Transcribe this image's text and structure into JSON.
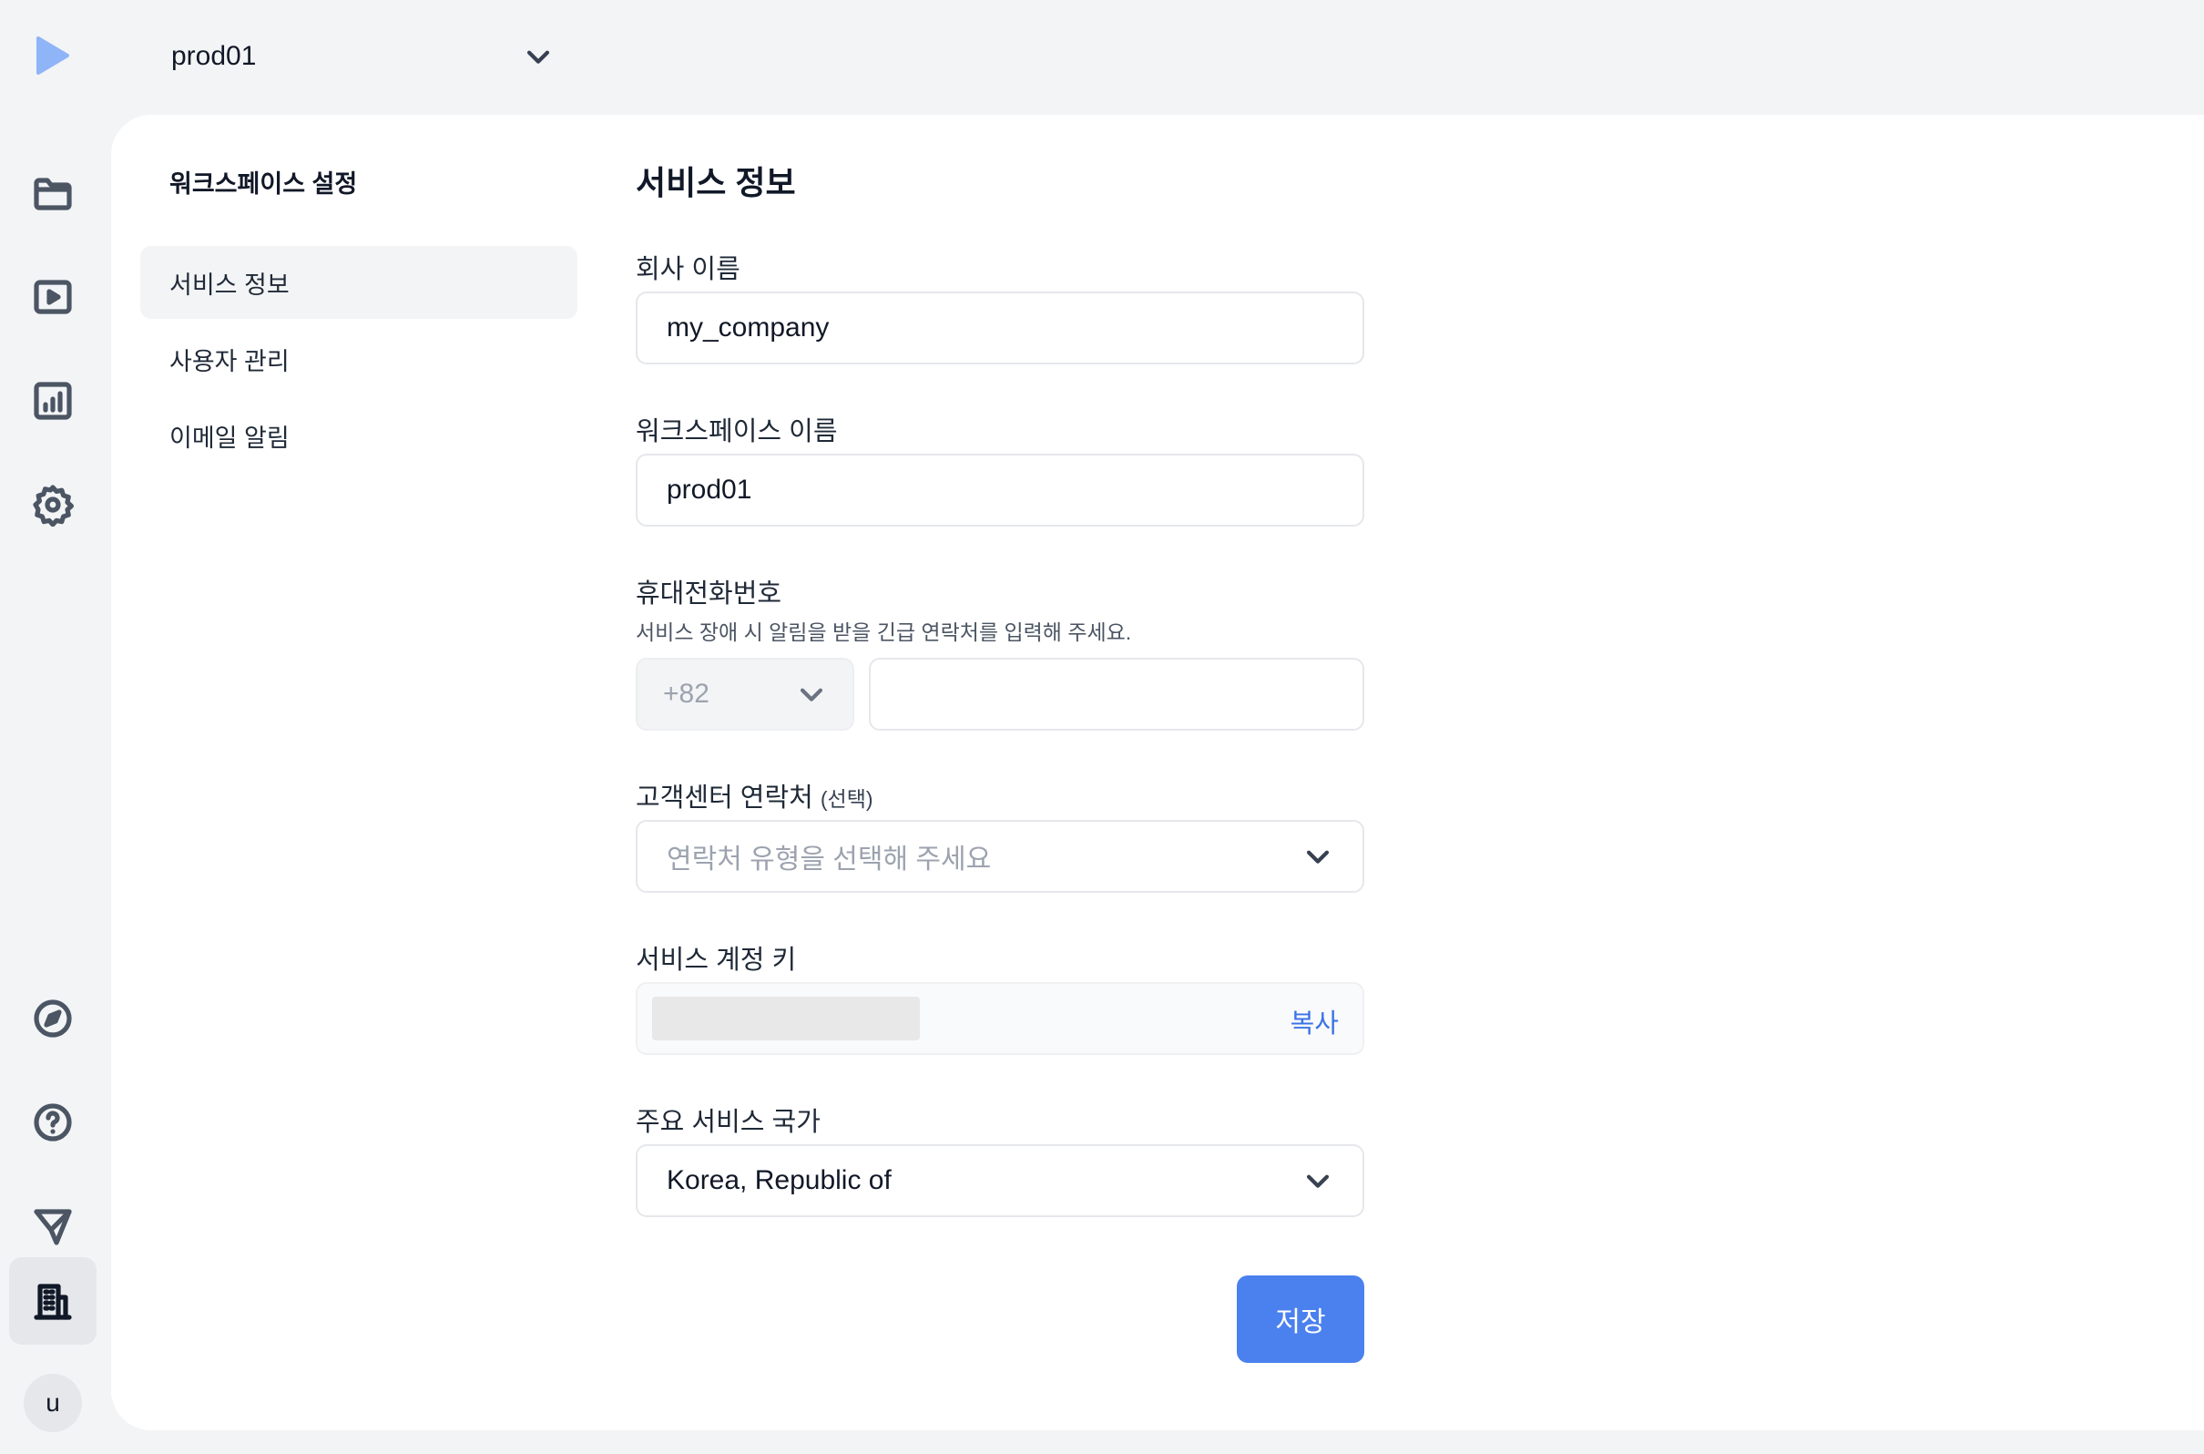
{
  "workspace_select": {
    "value": "prod01"
  },
  "sidebar": {
    "title": "워크스페이스 설정",
    "items": [
      {
        "label": "서비스 정보",
        "active": true
      },
      {
        "label": "사용자 관리",
        "active": false
      },
      {
        "label": "이메일 알림",
        "active": false
      }
    ]
  },
  "rail": {
    "top_icons": [
      "folder-icon",
      "play-icon",
      "chart-icon",
      "gear-icon"
    ],
    "bottom_icons": [
      "compass-icon",
      "help-icon",
      "send-icon",
      "building-icon"
    ],
    "active_icon": "building-icon",
    "avatar_initial": "u"
  },
  "main": {
    "title": "서비스 정보",
    "company_name": {
      "label": "회사 이름",
      "value": "my_company"
    },
    "workspace_name": {
      "label": "워크스페이스 이름",
      "value": "prod01"
    },
    "phone": {
      "label": "휴대전화번호",
      "hint": "서비스 장애 시 알림을 받을 긴급 연락처를 입력해 주세요.",
      "country_code": "+82",
      "value": ""
    },
    "support_contact": {
      "label": "고객센터 연락처",
      "optional": "(선택)",
      "placeholder": "연락처 유형을 선택해 주세요"
    },
    "service_key": {
      "label": "서비스 계정 키",
      "copy_label": "복사"
    },
    "country": {
      "label": "주요 서비스 국가",
      "value": "Korea, Republic of"
    },
    "save_label": "저장"
  },
  "colors": {
    "accent": "#4b81ee",
    "link": "#3b74e6",
    "background": "#f3f4f6",
    "logo": "#8fb4f7"
  }
}
